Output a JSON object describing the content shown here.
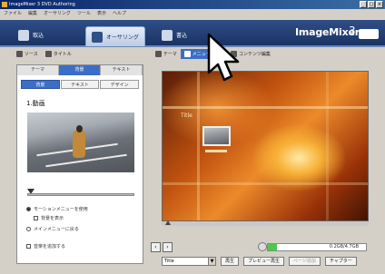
{
  "window": {
    "title": "ImageMixer 3 DVD Authoring"
  },
  "menu": {
    "items": [
      "ファイル",
      "編集",
      "オーサリング",
      "ツール",
      "表示",
      "ヘルプ"
    ]
  },
  "modes": [
    {
      "label": "取込",
      "icon": "import-icon"
    },
    {
      "label": "オーサリング",
      "icon": "authoring-icon"
    },
    {
      "label": "書込",
      "icon": "burn-icon"
    }
  ],
  "brand": {
    "name": "ImageMixer",
    "version": "3"
  },
  "subtoolbar": {
    "items": [
      {
        "label": "ソース",
        "icon": "source-icon"
      },
      {
        "label": "タイトル",
        "icon": "title-icon"
      },
      {
        "label": "テーマ",
        "icon": "theme-icon"
      },
      {
        "label": "メニュー",
        "icon": "menu-icon"
      },
      {
        "label": "コンテンツ編集",
        "icon": "content-edit-icon"
      }
    ]
  },
  "left": {
    "tabs": [
      "テーマ",
      "背景",
      "テキスト"
    ],
    "subtabs": [
      "背景",
      "テキスト",
      "デザイン"
    ],
    "section_title": "1.動画",
    "options": {
      "opt1": "モーションメニューを使用",
      "opt2": "背景を表示",
      "opt3": "メインメニューに戻る",
      "opt4": "音楽を追加する"
    }
  },
  "viewer": {
    "menu_title": "Title"
  },
  "status": {
    "capacity_text": "0.2GB/4.7GB",
    "used_fraction": 0.09
  },
  "bottom": {
    "select_value": "Title",
    "btn_play": "再生",
    "btn_preview": "プレビュー再生",
    "btn_disabled": "ページ追加",
    "btn_end": "チャプター"
  }
}
